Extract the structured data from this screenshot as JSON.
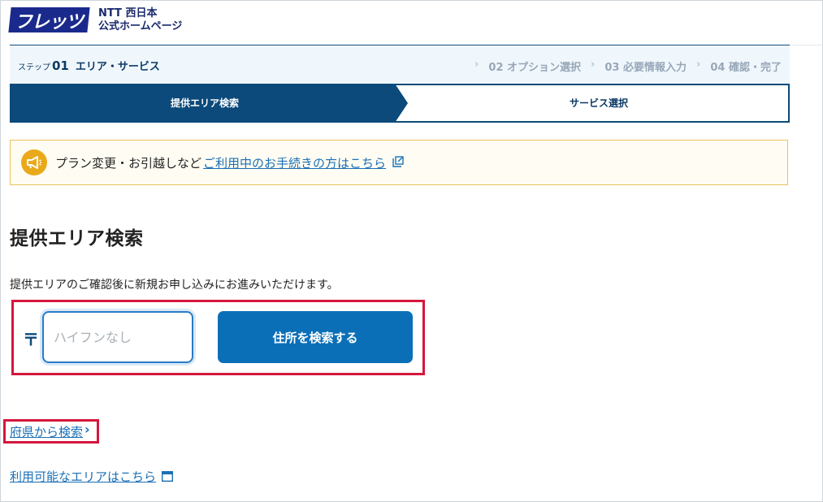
{
  "header": {
    "logo_text": "フレッツ",
    "brand_line1": "NTT 西日本",
    "brand_line2": "公式ホームページ"
  },
  "steps": {
    "current_prefix": "ステップ",
    "current_number": "01",
    "current_label": "エリア・サービス",
    "rest": [
      "02 オプション選択",
      "03 必要情報入力",
      "04 確認・完了"
    ]
  },
  "progress": {
    "step1": "提供エリア検索",
    "step2": "サービス選択",
    "active_color": "#0b4a7a"
  },
  "notice": {
    "text": "プラン変更・お引越しなど",
    "link": "ご利用中のお手続きの方はこちら",
    "icon": "megaphone-icon",
    "accent": "#e9a91a"
  },
  "main": {
    "title": "提供エリア検索",
    "description": "提供エリアのご確認後に新規お申し込みにお進みいただけます。",
    "postal_mark": "〒",
    "zip_placeholder": "ハイフンなし",
    "search_button": "住所を検索する",
    "pref_link": "府県から検索",
    "area_link": "利用可能なエリアはこちら"
  },
  "colors": {
    "brand_navy": "#1a2a8c",
    "primary": "#0b6fb8",
    "link": "#1b6fb5",
    "highlight_red": "#d6163c"
  }
}
